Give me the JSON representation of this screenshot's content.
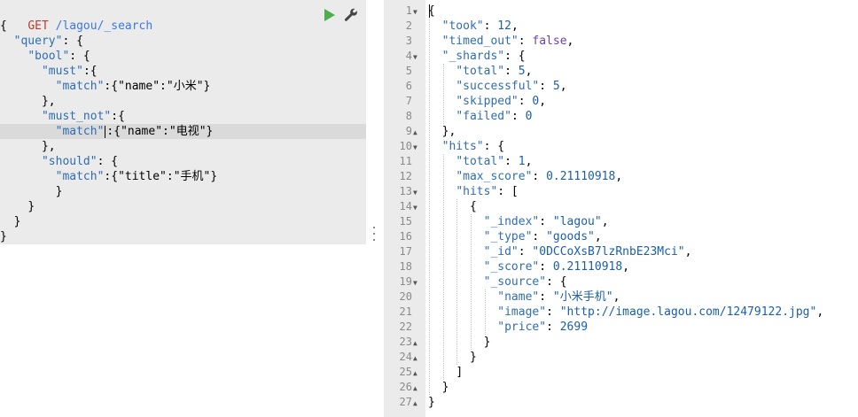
{
  "request": {
    "method": "GET",
    "path": "/lagou/_search",
    "lines": [
      {
        "i": 0,
        "t": "{"
      },
      {
        "i": 2,
        "k": "\"query\"",
        "t": ": {"
      },
      {
        "i": 4,
        "k": "\"bool\"",
        "t": ": {"
      },
      {
        "i": 6,
        "k": "\"must\"",
        "t": ":{"
      },
      {
        "i": 8,
        "k": "\"match\"",
        "t": ":{\"name\":\"小米\"}"
      },
      {
        "i": 6,
        "t": "},"
      },
      {
        "i": 6,
        "k": "\"must_not\"",
        "t": ":{"
      },
      {
        "i": 8,
        "k": "\"match\"",
        "t": ":{\"name\":\"电视\"}",
        "active": true
      },
      {
        "i": 6,
        "t": "},"
      },
      {
        "i": 6,
        "k": "\"should\"",
        "t": ": {"
      },
      {
        "i": 8,
        "k": "\"match\"",
        "t": ":{\"title\":\"手机\"}"
      },
      {
        "i": 8,
        "t": "}"
      },
      {
        "i": 4,
        "t": "}"
      },
      {
        "i": 2,
        "t": "}"
      },
      {
        "i": 0,
        "t": "}"
      }
    ]
  },
  "toolbar": {
    "run_icon": "play-icon",
    "settings_icon": "wrench-icon",
    "accent": "#4cae4c"
  },
  "response": {
    "lines": [
      {
        "n": "1",
        "f": "open",
        "i": 0,
        "p": [
          [
            "p",
            "{"
          ]
        ]
      },
      {
        "n": "2",
        "i": 2,
        "p": [
          [
            "k",
            "\"took\""
          ],
          [
            "p",
            ": "
          ],
          [
            "num",
            "12"
          ],
          [
            "p",
            ","
          ]
        ]
      },
      {
        "n": "3",
        "i": 2,
        "p": [
          [
            "k",
            "\"timed_out\""
          ],
          [
            "p",
            ": "
          ],
          [
            "bool",
            "false"
          ],
          [
            "p",
            ","
          ]
        ]
      },
      {
        "n": "4",
        "f": "open",
        "i": 2,
        "p": [
          [
            "k",
            "\"_shards\""
          ],
          [
            "p",
            ": {"
          ]
        ]
      },
      {
        "n": "5",
        "i": 4,
        "p": [
          [
            "k",
            "\"total\""
          ],
          [
            "p",
            ": "
          ],
          [
            "num",
            "5"
          ],
          [
            "p",
            ","
          ]
        ]
      },
      {
        "n": "6",
        "i": 4,
        "p": [
          [
            "k",
            "\"successful\""
          ],
          [
            "p",
            ": "
          ],
          [
            "num",
            "5"
          ],
          [
            "p",
            ","
          ]
        ]
      },
      {
        "n": "7",
        "i": 4,
        "p": [
          [
            "k",
            "\"skipped\""
          ],
          [
            "p",
            ": "
          ],
          [
            "num",
            "0"
          ],
          [
            "p",
            ","
          ]
        ]
      },
      {
        "n": "8",
        "i": 4,
        "p": [
          [
            "k",
            "\"failed\""
          ],
          [
            "p",
            ": "
          ],
          [
            "num",
            "0"
          ]
        ]
      },
      {
        "n": "9",
        "f": "close",
        "i": 2,
        "p": [
          [
            "p",
            "},"
          ]
        ]
      },
      {
        "n": "10",
        "f": "open",
        "i": 2,
        "p": [
          [
            "k",
            "\"hits\""
          ],
          [
            "p",
            ": {"
          ]
        ]
      },
      {
        "n": "11",
        "i": 4,
        "p": [
          [
            "k",
            "\"total\""
          ],
          [
            "p",
            ": "
          ],
          [
            "num",
            "1"
          ],
          [
            "p",
            ","
          ]
        ]
      },
      {
        "n": "12",
        "i": 4,
        "p": [
          [
            "k",
            "\"max_score\""
          ],
          [
            "p",
            ": "
          ],
          [
            "num",
            "0.21110918"
          ],
          [
            "p",
            ","
          ]
        ]
      },
      {
        "n": "13",
        "f": "open",
        "i": 4,
        "p": [
          [
            "k",
            "\"hits\""
          ],
          [
            "p",
            ": ["
          ]
        ]
      },
      {
        "n": "14",
        "f": "open",
        "i": 6,
        "p": [
          [
            "p",
            "{"
          ]
        ]
      },
      {
        "n": "15",
        "i": 8,
        "p": [
          [
            "k",
            "\"_index\""
          ],
          [
            "p",
            ": "
          ],
          [
            "str",
            "\"lagou\""
          ],
          [
            "p",
            ","
          ]
        ]
      },
      {
        "n": "16",
        "i": 8,
        "p": [
          [
            "k",
            "\"_type\""
          ],
          [
            "p",
            ": "
          ],
          [
            "str",
            "\"goods\""
          ],
          [
            "p",
            ","
          ]
        ]
      },
      {
        "n": "17",
        "i": 8,
        "p": [
          [
            "k",
            "\"_id\""
          ],
          [
            "p",
            ": "
          ],
          [
            "str",
            "\"0DCCoXsB7lzRnbE23Mci\""
          ],
          [
            "p",
            ","
          ]
        ]
      },
      {
        "n": "18",
        "i": 8,
        "p": [
          [
            "k",
            "\"_score\""
          ],
          [
            "p",
            ": "
          ],
          [
            "num",
            "0.21110918"
          ],
          [
            "p",
            ","
          ]
        ]
      },
      {
        "n": "19",
        "f": "open",
        "i": 8,
        "p": [
          [
            "k",
            "\"_source\""
          ],
          [
            "p",
            ": {"
          ]
        ]
      },
      {
        "n": "20",
        "i": 10,
        "p": [
          [
            "k",
            "\"name\""
          ],
          [
            "p",
            ": "
          ],
          [
            "str",
            "\"小米手机\""
          ],
          [
            "p",
            ","
          ]
        ]
      },
      {
        "n": "21",
        "i": 10,
        "p": [
          [
            "k",
            "\"image\""
          ],
          [
            "p",
            ": "
          ],
          [
            "str",
            "\"http://image.lagou.com/12479122.jpg\""
          ],
          [
            "p",
            ","
          ]
        ]
      },
      {
        "n": "22",
        "i": 10,
        "p": [
          [
            "k",
            "\"price\""
          ],
          [
            "p",
            ": "
          ],
          [
            "num",
            "2699"
          ]
        ]
      },
      {
        "n": "23",
        "f": "close",
        "i": 8,
        "p": [
          [
            "p",
            "}"
          ]
        ]
      },
      {
        "n": "24",
        "f": "close",
        "i": 6,
        "p": [
          [
            "p",
            "}"
          ]
        ]
      },
      {
        "n": "25",
        "f": "close",
        "i": 4,
        "p": [
          [
            "p",
            "]"
          ]
        ]
      },
      {
        "n": "26",
        "f": "close",
        "i": 2,
        "p": [
          [
            "p",
            "}"
          ]
        ]
      },
      {
        "n": "27",
        "f": "close",
        "i": 0,
        "p": [
          [
            "p",
            "}"
          ]
        ]
      }
    ]
  }
}
